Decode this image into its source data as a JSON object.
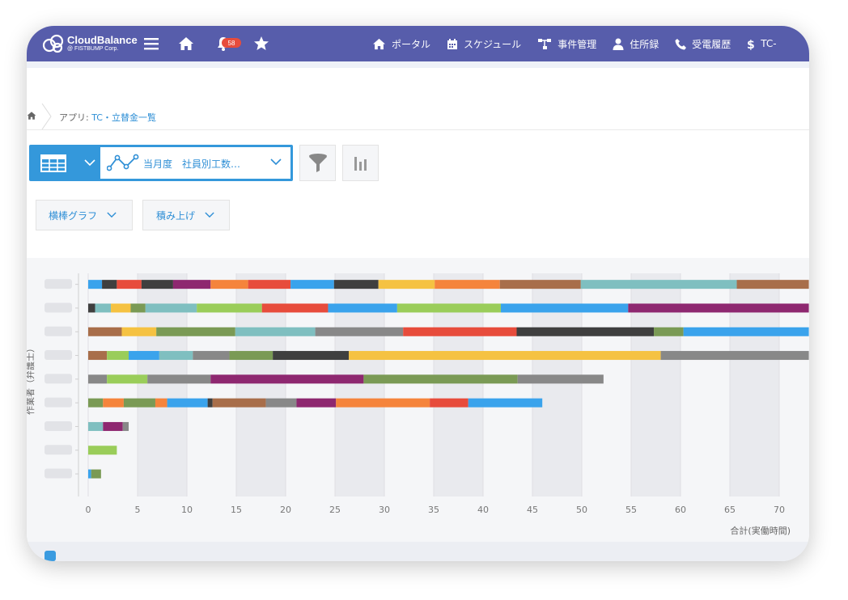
{
  "app": {
    "logo_name": "CloudBalance",
    "logo_sub": "@ FISTBUMP Corp.",
    "notification_count": "58"
  },
  "nav": {
    "links": [
      "ポータル",
      "スケジュール",
      "事件管理",
      "住所録",
      "受電履歴",
      "TC-"
    ]
  },
  "breadcrumb": {
    "prefix": "アプリ: ",
    "app_name": "TC・立替金一覧"
  },
  "view": {
    "selected_label": "当月度　社員別工数…"
  },
  "options": {
    "chart_type": "横棒グラフ",
    "stacking": "積み上げ"
  },
  "icons": {
    "menu": "menu-icon",
    "home": "home-icon",
    "bell": "bell-icon",
    "star": "star-icon",
    "filter": "filter-icon",
    "graph": "bar-graph-icon"
  },
  "colors": {
    "nav": "#575dab",
    "accent": "#3498db",
    "link": "#2f8fd6"
  },
  "chart_data": {
    "type": "bar",
    "orientation": "horizontal",
    "stacked": true,
    "xlabel": "合計(実働時間)",
    "ylabel": "作業者（弁護士）",
    "xlim": [
      0,
      73
    ],
    "x_ticks": [
      0,
      5,
      10,
      15,
      20,
      25,
      30,
      35,
      40,
      45,
      50,
      55,
      60,
      65,
      70
    ],
    "grid": true,
    "categories": [
      "",
      "",
      "",
      "",
      "",
      "",
      "",
      "",
      ""
    ],
    "rows": [
      [
        {
          "v": 1.4,
          "c": "#3aa3ec"
        },
        {
          "v": 1.5,
          "c": "#3f3f3f"
        },
        {
          "v": 2.5,
          "c": "#e74c3c"
        },
        {
          "v": 3.2,
          "c": "#3f3f3f"
        },
        {
          "v": 3.8,
          "c": "#8e2870"
        },
        {
          "v": 3.8,
          "c": "#f5843c"
        },
        {
          "v": 4.3,
          "c": "#e74c3c"
        },
        {
          "v": 4.4,
          "c": "#3aa3ec"
        },
        {
          "v": 4.5,
          "c": "#3f3f3f"
        },
        {
          "v": 5.7,
          "c": "#f5c242"
        },
        {
          "v": 6.6,
          "c": "#f5843c"
        },
        {
          "v": 8.2,
          "c": "#a86e4a"
        },
        {
          "v": 15.8,
          "c": "#7fbfc0"
        },
        {
          "v": 7.3,
          "c": "#a86e4a"
        }
      ],
      [
        {
          "v": 0.7,
          "c": "#3f3f3f"
        },
        {
          "v": 1.6,
          "c": "#7fbfc0"
        },
        {
          "v": 2.0,
          "c": "#f5c242"
        },
        {
          "v": 1.5,
          "c": "#7a9a55"
        },
        {
          "v": 5.2,
          "c": "#7fbfc0"
        },
        {
          "v": 6.6,
          "c": "#9acd5a"
        },
        {
          "v": 6.7,
          "c": "#e74c3c"
        },
        {
          "v": 7.0,
          "c": "#3aa3ec"
        },
        {
          "v": 10.5,
          "c": "#9acd5a"
        },
        {
          "v": 12.9,
          "c": "#3aa3ec"
        },
        {
          "v": 18.3,
          "c": "#8e2870"
        }
      ],
      [
        {
          "v": 3.4,
          "c": "#a86e4a"
        },
        {
          "v": 3.5,
          "c": "#f5c242"
        },
        {
          "v": 8.0,
          "c": "#7a9a55"
        },
        {
          "v": 8.1,
          "c": "#7fbfc0"
        },
        {
          "v": 8.9,
          "c": "#888888"
        },
        {
          "v": 11.5,
          "c": "#e74c3c"
        },
        {
          "v": 13.9,
          "c": "#3f3f3f"
        },
        {
          "v": 3.0,
          "c": "#7a9a55"
        },
        {
          "v": 12.7,
          "c": "#3aa3ec"
        }
      ],
      [
        {
          "v": 1.9,
          "c": "#a86e4a"
        },
        {
          "v": 2.2,
          "c": "#9acd5a"
        },
        {
          "v": 3.1,
          "c": "#3aa3ec"
        },
        {
          "v": 3.4,
          "c": "#7fbfc0"
        },
        {
          "v": 3.7,
          "c": "#888888"
        },
        {
          "v": 4.4,
          "c": "#7a9a55"
        },
        {
          "v": 7.7,
          "c": "#3f3f3f"
        },
        {
          "v": 31.6,
          "c": "#f5c242"
        },
        {
          "v": 15.0,
          "c": "#888888"
        }
      ],
      [
        {
          "v": 1.9,
          "c": "#888888"
        },
        {
          "v": 4.1,
          "c": "#9acd5a"
        },
        {
          "v": 6.4,
          "c": "#888888"
        },
        {
          "v": 15.5,
          "c": "#8e2870"
        },
        {
          "v": 15.6,
          "c": "#7a9a55"
        },
        {
          "v": 8.7,
          "c": "#888888"
        }
      ],
      [
        {
          "v": 1.5,
          "c": "#7a9a55"
        },
        {
          "v": 2.1,
          "c": "#f5843c"
        },
        {
          "v": 3.2,
          "c": "#7a9a55"
        },
        {
          "v": 1.2,
          "c": "#f5843c"
        },
        {
          "v": 4.1,
          "c": "#3aa3ec"
        },
        {
          "v": 0.5,
          "c": "#3f3f3f"
        },
        {
          "v": 5.4,
          "c": "#a86e4a"
        },
        {
          "v": 3.1,
          "c": "#888888"
        },
        {
          "v": 4.0,
          "c": "#8e2870"
        },
        {
          "v": 9.5,
          "c": "#f5843c"
        },
        {
          "v": 3.9,
          "c": "#e74c3c"
        },
        {
          "v": 7.5,
          "c": "#3aa3ec"
        }
      ],
      [
        {
          "v": 1.5,
          "c": "#7fbfc0"
        },
        {
          "v": 2.0,
          "c": "#8e2870"
        },
        {
          "v": 0.6,
          "c": "#888888"
        }
      ],
      [
        {
          "v": 2.9,
          "c": "#9acd5a"
        }
      ],
      [
        {
          "v": 0.3,
          "c": "#3aa3ec"
        },
        {
          "v": 1.0,
          "c": "#7a9a55"
        }
      ]
    ]
  }
}
